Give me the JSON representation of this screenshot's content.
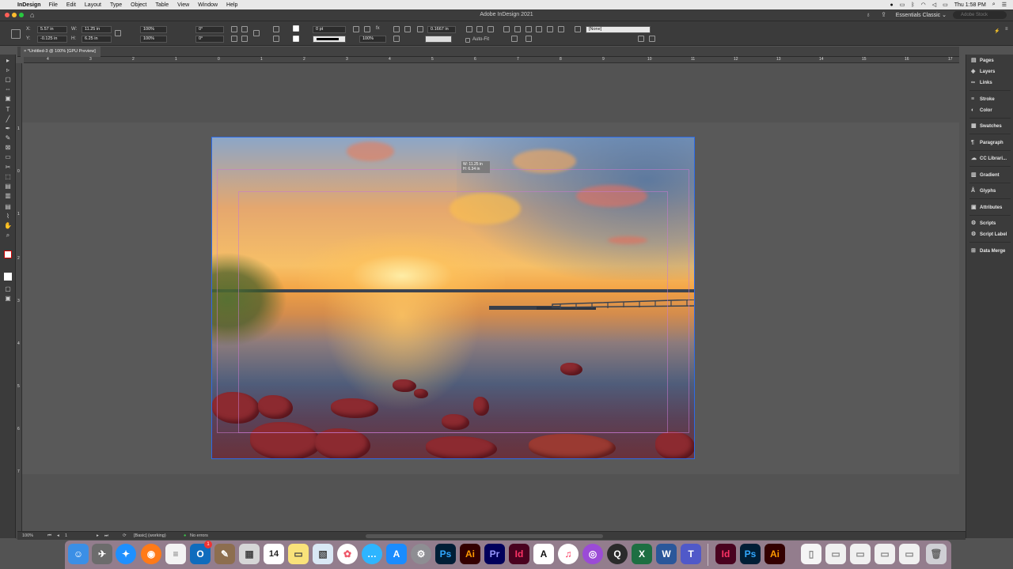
{
  "menubar": {
    "app": "InDesign",
    "items": [
      "File",
      "Edit",
      "Layout",
      "Type",
      "Object",
      "Table",
      "View",
      "Window",
      "Help"
    ],
    "clock": "Thu 1:58 PM"
  },
  "titlebar": {
    "title": "Adobe InDesign 2021",
    "workspace": "Essentials Classic",
    "search_placeholder": "Adobe Stock"
  },
  "control": {
    "x_label": "X:",
    "x_value": "5.57 in",
    "y_label": "Y:",
    "y_value": "-0.125 in",
    "w_label": "W:",
    "w_value": "11.25 in",
    "h_label": "H:",
    "h_value": "6.25 in",
    "scale_x": "100%",
    "scale_y": "100%",
    "rotate": "0°",
    "shear": "0°",
    "stroke_weight": "0 pt",
    "opacity": "100%",
    "gap_value": "0.1667 in",
    "autofit_label": "Auto-Fit",
    "object_style": "[None]"
  },
  "doctab": {
    "label": "*Untitled-3 @ 100% [GPU Preview]"
  },
  "ruler_h": [
    "4",
    "3",
    "2",
    "1",
    "0",
    "1",
    "2",
    "3",
    "4",
    "5",
    "6",
    "7",
    "8",
    "9",
    "10",
    "11",
    "12",
    "13",
    "14",
    "15",
    "16",
    "17"
  ],
  "ruler_v": [
    "1",
    "0",
    "1",
    "2",
    "3",
    "4",
    "5",
    "6",
    "7"
  ],
  "tooltip": {
    "w": "W: 11.25 in",
    "h": "H: 6.34 in"
  },
  "panels": [
    "Pages",
    "Layers",
    "Links",
    "Stroke",
    "Color",
    "Swatches",
    "Paragraph",
    "CC Librari...",
    "Gradient",
    "Glyphs",
    "Attributes",
    "Scripts",
    "Script Label",
    "Data Merge"
  ],
  "status": {
    "zoom": "100%",
    "page": "1",
    "preflight_profile": "[Basic] (working)",
    "errors": "No errors"
  },
  "dock": {
    "apps": [
      "Finder",
      "Launchpad",
      "Safari",
      "Firefox",
      "TextEdit",
      "Outlook",
      "Notes",
      "Calculator",
      "Calendar",
      "Stickies",
      "Preview",
      "Photos",
      "Messages",
      "App Store",
      "System Preferences",
      "Photoshop",
      "Illustrator",
      "Premiere Pro",
      "InDesign",
      "Acrobat",
      "Music",
      "Podcasts",
      "QuickTime",
      "Excel",
      "Word",
      "Teams",
      "InDesign",
      "Photoshop",
      "Illustrator",
      "Files",
      "Trash"
    ],
    "calendar_day": "14",
    "badge": "1"
  },
  "colors": {
    "accent": "#2e6be6",
    "panel_bg": "#3b3b3b",
    "pasteboard": "#535353",
    "indesign": "#49021f",
    "photoshop": "#001e36",
    "illustrator": "#330000"
  }
}
